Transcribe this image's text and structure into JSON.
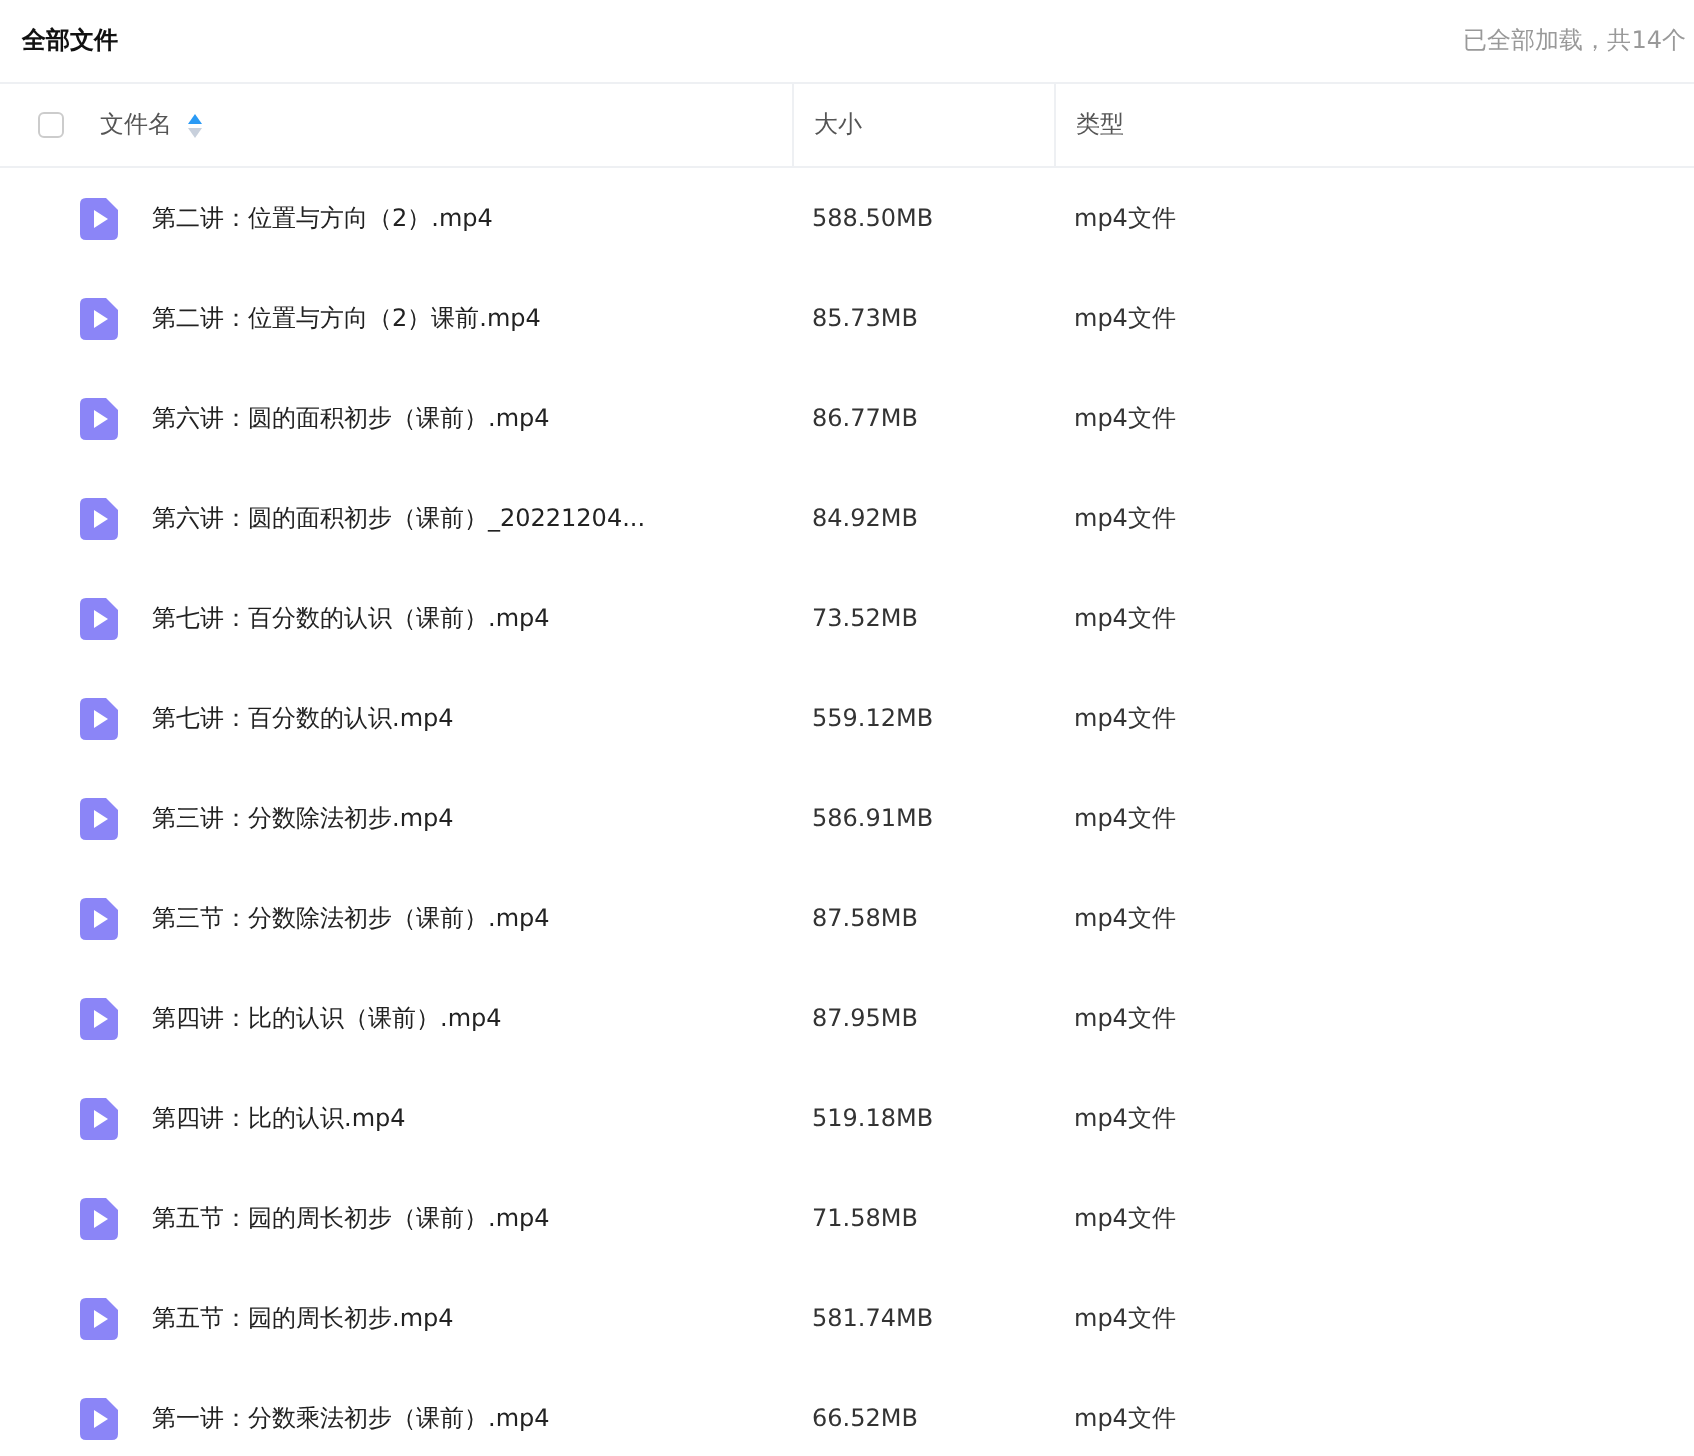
{
  "header": {
    "title": "全部文件",
    "status": "已全部加载，共14个"
  },
  "table": {
    "select_all": {
      "checked": false
    },
    "columns": [
      {
        "label": "文件名",
        "sorted_ascending": true
      },
      {
        "label": "大小"
      },
      {
        "label": "类型"
      }
    ],
    "rows": [
      {
        "name": "第二讲：位置与方向（2）.mp4",
        "size": "588.50MB",
        "type": "mp4文件"
      },
      {
        "name": "第二讲：位置与方向（2）课前.mp4",
        "size": "85.73MB",
        "type": "mp4文件"
      },
      {
        "name": "第六讲：圆的面积初步（课前）.mp4",
        "size": "86.77MB",
        "type": "mp4文件"
      },
      {
        "name": "第六讲：圆的面积初步（课前）_20221204...",
        "size": "84.92MB",
        "type": "mp4文件"
      },
      {
        "name": "第七讲：百分数的认识（课前）.mp4",
        "size": "73.52MB",
        "type": "mp4文件"
      },
      {
        "name": "第七讲：百分数的认识.mp4",
        "size": "559.12MB",
        "type": "mp4文件"
      },
      {
        "name": "第三讲：分数除法初步.mp4",
        "size": "586.91MB",
        "type": "mp4文件"
      },
      {
        "name": "第三节：分数除法初步（课前）.mp4",
        "size": "87.58MB",
        "type": "mp4文件"
      },
      {
        "name": "第四讲：比的认识（课前）.mp4",
        "size": "87.95MB",
        "type": "mp4文件"
      },
      {
        "name": "第四讲：比的认识.mp4",
        "size": "519.18MB",
        "type": "mp4文件"
      },
      {
        "name": "第五节：园的周长初步（课前）.mp4",
        "size": "71.58MB",
        "type": "mp4文件"
      },
      {
        "name": "第五节：园的周长初步.mp4",
        "size": "581.74MB",
        "type": "mp4文件"
      },
      {
        "name": "第一讲：分数乘法初步（课前）.mp4",
        "size": "66.52MB",
        "type": "mp4文件"
      }
    ]
  }
}
